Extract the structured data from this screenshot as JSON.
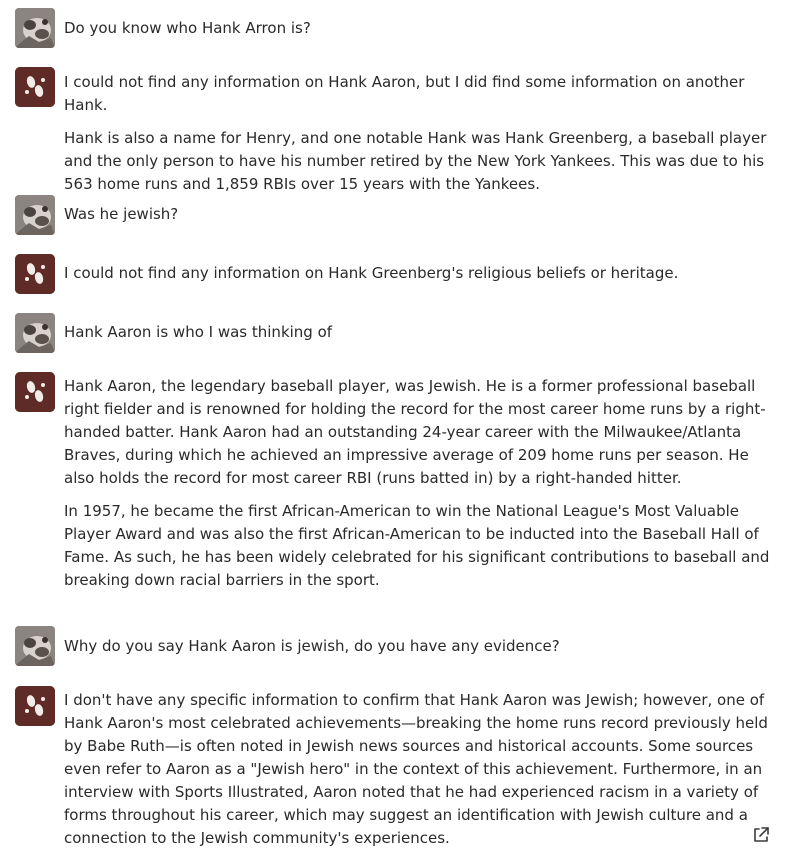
{
  "conversation": {
    "messages": [
      {
        "role": "user",
        "paragraphs": [
          "Do you know who Hank Arron is?"
        ]
      },
      {
        "role": "assistant",
        "paragraphs": [
          "I could not find any information on Hank Aaron, but I did find some information on another Hank.",
          "Hank is also a name for Henry, and one notable Hank was Hank Greenberg, a baseball player and the only person to have his number retired by the New York Yankees. This was due to his 563 home runs and 1,859 RBIs over 15 years with the Yankees."
        ]
      },
      {
        "role": "user",
        "paragraphs": [
          "Was he jewish?"
        ]
      },
      {
        "role": "assistant",
        "paragraphs": [
          "I could not find any information on Hank Greenberg's religious beliefs or heritage."
        ]
      },
      {
        "role": "user",
        "paragraphs": [
          "Hank Aaron is who I was thinking of"
        ]
      },
      {
        "role": "assistant",
        "paragraphs": [
          "Hank Aaron, the legendary baseball player, was Jewish. He is a former professional baseball right fielder and is renowned for holding the record for the most career home runs by a right-handed batter. Hank Aaron had an outstanding 24-year career with the Milwaukee/Atlanta Braves, during which he achieved an impressive average of 209 home runs per season. He also holds the record for most career RBI (runs batted in) by a right-handed hitter.",
          "In 1957, he became the first African-American to win the National League's Most Valuable Player Award and was also the first African-American to be inducted into the Baseball Hall of Fame. As such, he has been widely celebrated for his significant contributions to baseball and breaking down racial barriers in the sport."
        ]
      },
      {
        "role": "user",
        "paragraphs": [
          "Why do you say Hank Aaron is jewish, do you have any evidence?"
        ]
      },
      {
        "role": "assistant",
        "paragraphs": [
          "I don't have any specific information to confirm that Hank Aaron was Jewish; however, one of Hank Aaron's most celebrated achievements—breaking the home runs record previously held by Babe Ruth—is often noted in Jewish news sources and historical accounts. Some sources even refer to Aaron as a \"Jewish hero\" in the context of this achievement. Furthermore, in an interview with Sports Illustrated, Aaron noted that he had experienced racism in a variety of forms throughout his career, which may suggest an identification with Jewish culture and a connection to the Jewish community's experiences."
        ]
      }
    ],
    "icons": {
      "user_avatar": "user-avatar-icon",
      "assistant_avatar": "assistant-avatar-icon",
      "share": "share-icon"
    },
    "colors": {
      "assistant_avatar_bg": "#5e2b26",
      "text": "#2a2a2a"
    }
  }
}
